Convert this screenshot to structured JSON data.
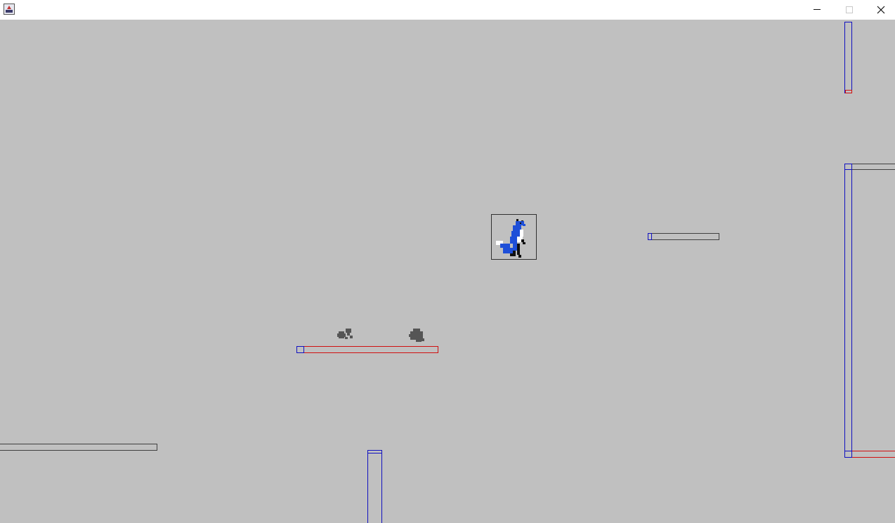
{
  "window": {
    "title": "",
    "icon": "java-app-icon",
    "controls": [
      "minimize",
      "maximize",
      "close"
    ]
  },
  "scene": {
    "background_color": "#c0c0c0",
    "platform_color": "#404040",
    "hitbox_color_blue": "#1010c0",
    "hitbox_color_red": "#d01010",
    "player": {
      "sprite": "blue-fox-sprite",
      "colors": [
        "#1e4fd8",
        "#ffffff",
        "#111111"
      ]
    },
    "enemies": [
      {
        "sprite": "gray-blob-enemy",
        "color": "#555555"
      },
      {
        "sprite": "gray-creature-enemy",
        "color": "#555555"
      }
    ]
  }
}
